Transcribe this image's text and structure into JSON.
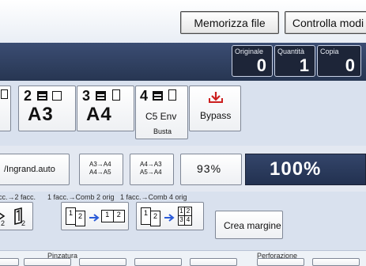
{
  "top_buttons": {
    "memorizza": "Memorizza file",
    "controlla": "Controlla modi"
  },
  "counters": [
    {
      "label": "Originale",
      "value": "0"
    },
    {
      "label": "Quantità",
      "value": "1"
    },
    {
      "label": "Copia",
      "value": "0"
    }
  ],
  "paper_trays": [
    {
      "num": "2",
      "size": "A3",
      "note": ""
    },
    {
      "num": "3",
      "size": "A4",
      "note": ""
    },
    {
      "num": "4",
      "size": "C5 Env",
      "note": "Busta"
    }
  ],
  "bypass": {
    "label": "Bypass"
  },
  "reduce_enlarge": {
    "auto": "/Ingrand.auto",
    "preset1": [
      "A3→A4",
      "A4→A5"
    ],
    "preset2": [
      "A4→A3",
      "A5→A4"
    ],
    "current_zoom": "93%",
    "full_size": "100%"
  },
  "duplex_labels": {
    "first": "cc.→2 facc.",
    "second": "1 facc.→Comb 2 orig",
    "third": "1 facc.→Comb 4 orig"
  },
  "duplex_icons": {
    "left": [
      "2"
    ],
    "comb2": [
      "1",
      "2",
      "1",
      "2"
    ],
    "comb4": [
      "1",
      "2",
      "1",
      "2",
      "3",
      "4"
    ]
  },
  "crea_margine": "Crea margine",
  "bottom_labels": {
    "left": "Pinzatura",
    "right": "Perforazione"
  },
  "colors": {
    "header": "#2f3f63",
    "section_bg": "#d9e1ee",
    "accent_red": "#cc1f1f"
  }
}
